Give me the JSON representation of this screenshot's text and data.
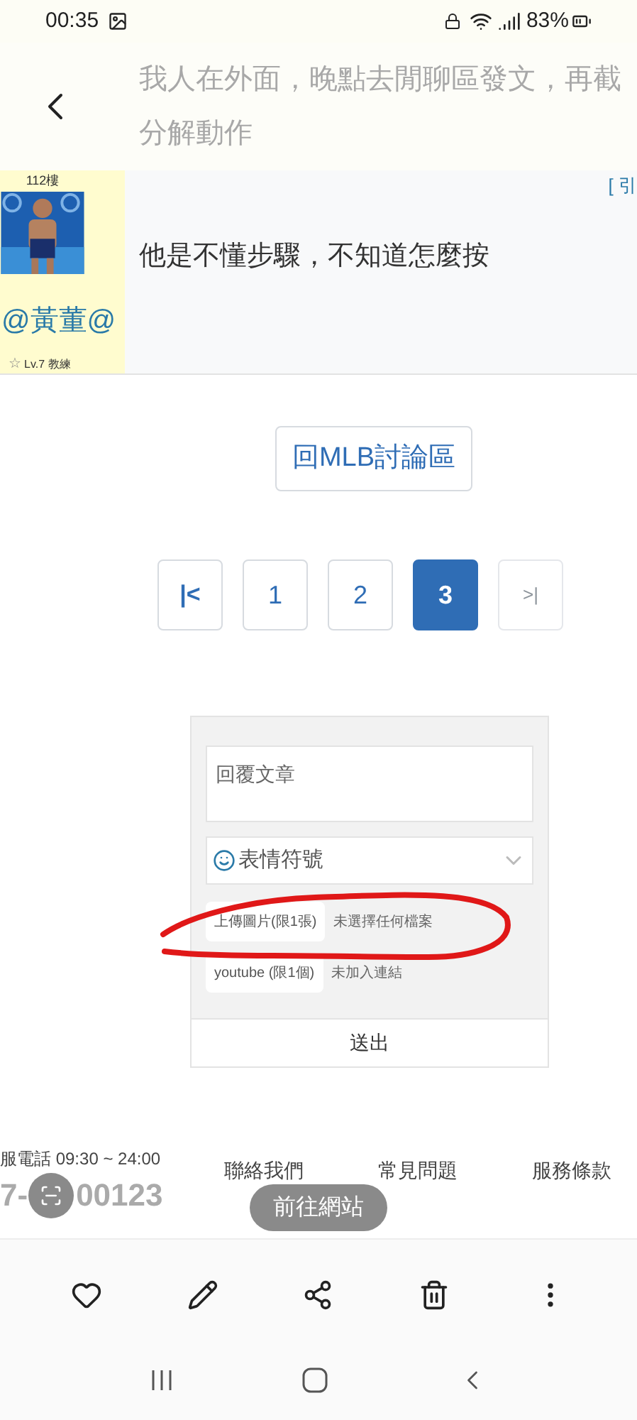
{
  "status_bar": {
    "time": "00:35",
    "battery": "83%"
  },
  "header": {
    "title_lines": [
      "我人在外面，晚點去閒聊區發文，再截",
      "分解動作"
    ]
  },
  "post": {
    "floor": "112樓",
    "author": "@黃董@",
    "rank_icon": "☆",
    "rank": "Lv.7 教練",
    "quote_link": "[ 引",
    "content": "他是不懂步驟，不知道怎麼按"
  },
  "back_to_board": "回MLB討論區",
  "pagination": [
    {
      "label": "|<",
      "kind": "first",
      "disabled": false,
      "selected": false
    },
    {
      "label": "1",
      "kind": "page",
      "disabled": false,
      "selected": false
    },
    {
      "label": "2",
      "kind": "page",
      "disabled": false,
      "selected": false
    },
    {
      "label": "3",
      "kind": "page",
      "disabled": false,
      "selected": true
    },
    {
      "label": ">|",
      "kind": "last",
      "disabled": true,
      "selected": false
    }
  ],
  "reply_form": {
    "textarea_placeholder": "回覆文章",
    "emoji_select": "表情符號",
    "attachments": [
      {
        "button": "上傳圖片(限1張)",
        "status": "未選擇任何檔案"
      },
      {
        "button": "youtube (限1個)",
        "status": "未加入連結"
      }
    ],
    "submit": "送出"
  },
  "footer": {
    "hours": "服電話 09:30 ~ 24:00",
    "phone_start": "7-",
    "phone_end": "00123",
    "links": [
      "聯絡我們",
      "常見問題",
      "服務條款"
    ]
  },
  "go_to_site": "前往網站"
}
